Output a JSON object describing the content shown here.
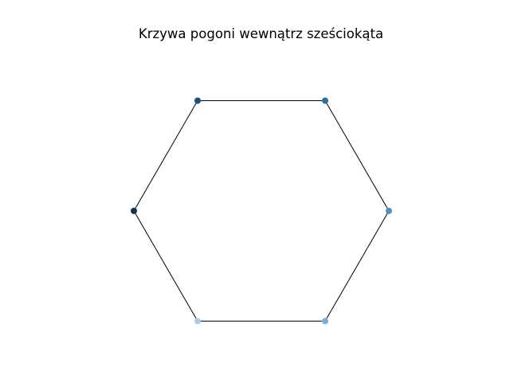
{
  "chart_data": {
    "type": "scatter",
    "title": "Krzywa pogoni wewnątrz sześciokąta",
    "xlabel": "",
    "ylabel": "",
    "axes_visible": false,
    "grid": false,
    "legend": "none",
    "xlim": [
      -1.1,
      1.1
    ],
    "ylim": [
      -1.1,
      1.1
    ],
    "outline": {
      "closed": true,
      "color": "#000000",
      "points": [
        {
          "x": 1.0,
          "y": 0.0
        },
        {
          "x": 0.5,
          "y": 0.866
        },
        {
          "x": -0.5,
          "y": 0.866
        },
        {
          "x": -1.0,
          "y": 0.0
        },
        {
          "x": -0.5,
          "y": -0.866
        },
        {
          "x": 0.5,
          "y": -0.866
        }
      ]
    },
    "points": [
      {
        "x": 1.0,
        "y": 0.0,
        "color": "#4a90c4"
      },
      {
        "x": 0.5,
        "y": 0.866,
        "color": "#2f6d9c"
      },
      {
        "x": -0.5,
        "y": 0.866,
        "color": "#1f4e74"
      },
      {
        "x": -1.0,
        "y": 0.0,
        "color": "#12344f"
      },
      {
        "x": -0.5,
        "y": -0.866,
        "color": "#a9cbe6"
      },
      {
        "x": 0.5,
        "y": -0.866,
        "color": "#79add8"
      }
    ]
  }
}
